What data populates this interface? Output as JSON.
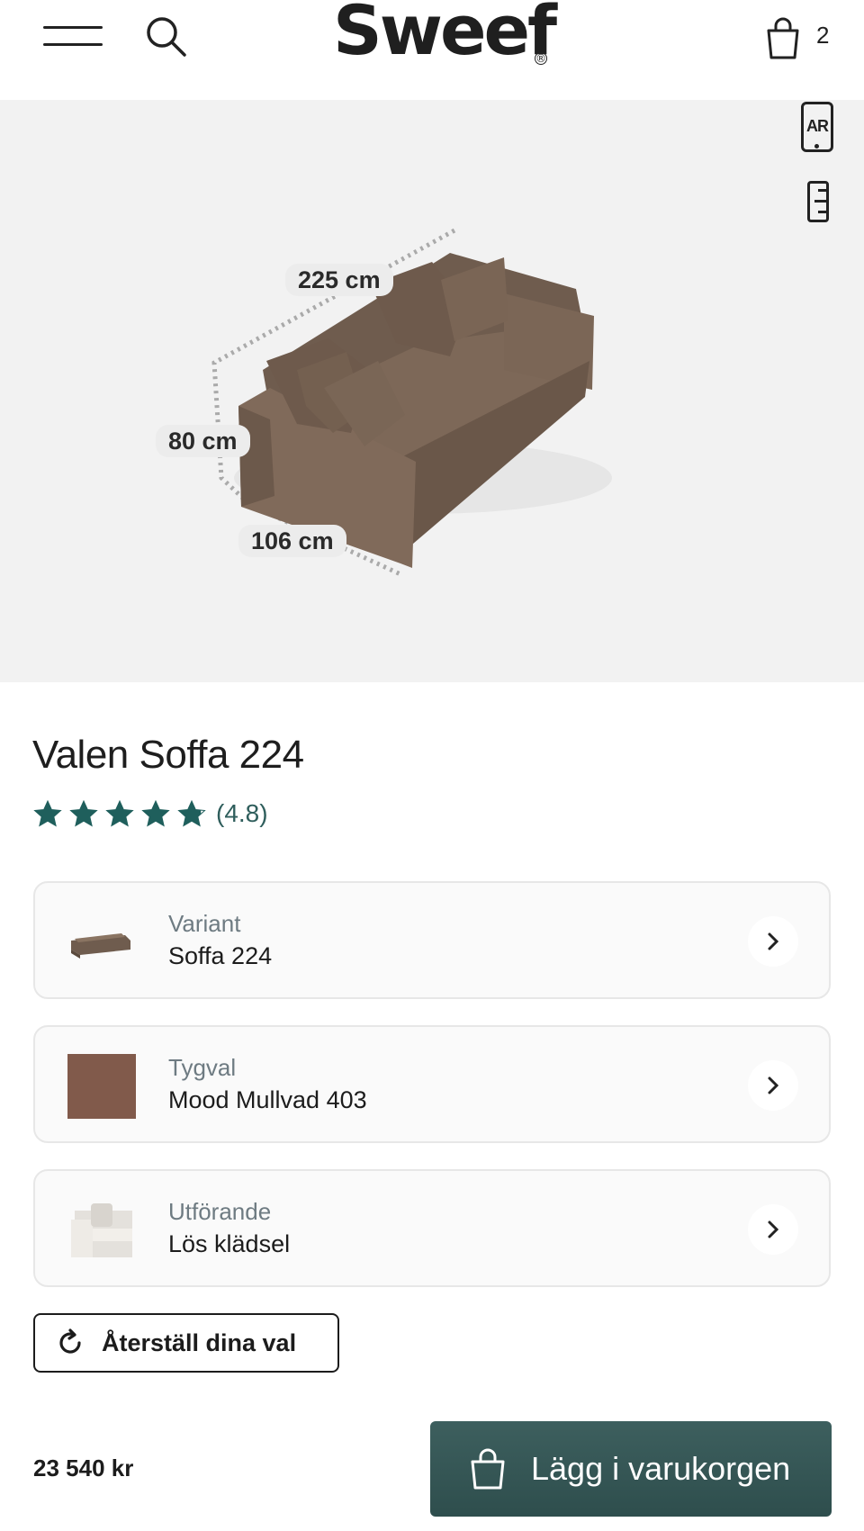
{
  "header": {
    "logo_text": "Sweef",
    "logo_mark": "®",
    "cart_count": "2",
    "icons": [
      "menu-icon",
      "search-icon",
      "shopping-bag-icon"
    ]
  },
  "hero": {
    "ar_label": "AR",
    "dimensions": {
      "width": "225 cm",
      "height": "80 cm",
      "depth": "106 cm"
    },
    "background_color": "#f2f2f2",
    "sofa_color": "#7a6656"
  },
  "product": {
    "title": "Valen Soffa 224",
    "rating_value": 4.8,
    "rating_max": 5,
    "rating_text": "(4.8)",
    "star_color": "#1f5f5c"
  },
  "options": [
    {
      "label": "Variant",
      "value": "Soffa 224",
      "thumb": "sofa-thumbnail"
    },
    {
      "label": "Tygval",
      "value": "Mood Mullvad 403",
      "thumb": "fabric-swatch"
    },
    {
      "label": "Utförande",
      "value": "Lös klädsel",
      "thumb": "slipcover-sofa-thumbnail"
    }
  ],
  "reset": {
    "label": "Återställ dina val"
  },
  "purchase": {
    "price": "23 540 kr",
    "add_to_cart_label": "Lägg i varukorgen",
    "button_color": "#3a5b5a"
  }
}
